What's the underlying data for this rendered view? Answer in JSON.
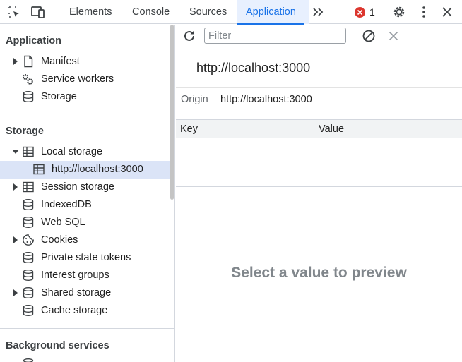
{
  "tabs": [
    {
      "label": "Elements"
    },
    {
      "label": "Console"
    },
    {
      "label": "Sources"
    },
    {
      "label": "Application"
    }
  ],
  "active_tab": "Application",
  "error_count": "1",
  "sidebar": {
    "sections": [
      {
        "title": "Application"
      },
      {
        "title": "Storage"
      },
      {
        "title": "Background services"
      }
    ],
    "items": [
      {
        "label": "Manifest",
        "icon": "document-icon",
        "expandable": true
      },
      {
        "label": "Service workers",
        "icon": "gears-icon",
        "expandable": false
      },
      {
        "label": "Storage",
        "icon": "database-icon",
        "expandable": false
      },
      {
        "label": "Local storage",
        "icon": "table-icon",
        "expandable": true,
        "expanded": true
      },
      {
        "label": "http://localhost:3000",
        "icon": "table-icon",
        "selected": true
      },
      {
        "label": "Session storage",
        "icon": "table-icon",
        "expandable": true
      },
      {
        "label": "IndexedDB",
        "icon": "database-icon"
      },
      {
        "label": "Web SQL",
        "icon": "database-icon"
      },
      {
        "label": "Cookies",
        "icon": "cookie-icon",
        "expandable": true
      },
      {
        "label": "Private state tokens",
        "icon": "database-icon"
      },
      {
        "label": "Interest groups",
        "icon": "database-icon"
      },
      {
        "label": "Shared storage",
        "icon": "database-icon",
        "expandable": true
      },
      {
        "label": "Cache storage",
        "icon": "database-icon"
      }
    ]
  },
  "main": {
    "filter_placeholder": "Filter",
    "heading": "http://localhost:3000",
    "origin_key": "Origin",
    "origin_value": "http://localhost:3000",
    "columns": [
      "Key",
      "Value"
    ],
    "empty_preview": "Select a value to preview"
  },
  "colors": {
    "accent": "#1a73e8",
    "error": "#dc362e",
    "selected_row": "#dbe4f7"
  }
}
